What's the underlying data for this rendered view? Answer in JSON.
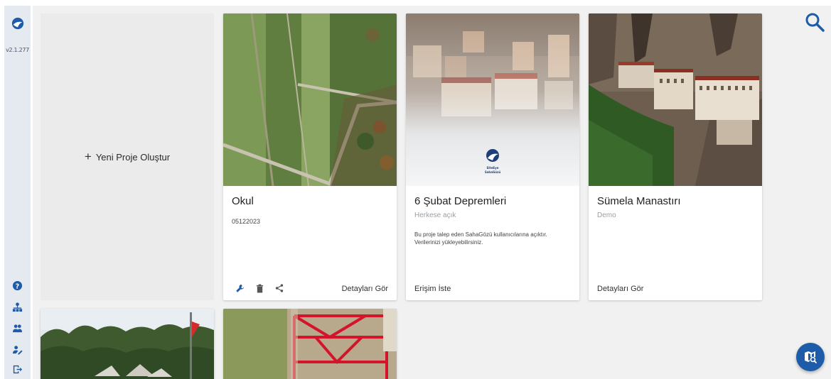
{
  "sidebar": {
    "logo_icon": "globe-logo-icon",
    "version": "v2.1.277",
    "buttons": [
      {
        "name": "help-icon"
      },
      {
        "name": "organization-icon"
      },
      {
        "name": "users-icon"
      },
      {
        "name": "user-edit-icon"
      },
      {
        "name": "logout-icon"
      }
    ]
  },
  "new_project": {
    "plus": "+",
    "label": "Yeni Proje Oluştur"
  },
  "projects": [
    {
      "title": "Okul",
      "code": "05122023",
      "tools": [
        "wrench-icon",
        "trash-icon",
        "share-icon"
      ],
      "action": "Detayları Gör"
    },
    {
      "title": "6 Şubat Depremleri",
      "subtitle": "Herkese açık",
      "description": "Bu proje talep eden SahaGözü kullanıcılarına açıktır. Verilerinizi yükleyebilirsiniz.",
      "action": "Erişim İste"
    },
    {
      "title": "Sümela Manastırı",
      "subtitle": "Demo",
      "action": "Detayları Gör"
    }
  ],
  "colors": {
    "accent": "#1e5ba8",
    "sidebar_bg": "#e5e9f0",
    "main_bg": "#f1f1f1"
  },
  "search_icon": "search-icon",
  "fab_icon": "map-search-icon"
}
